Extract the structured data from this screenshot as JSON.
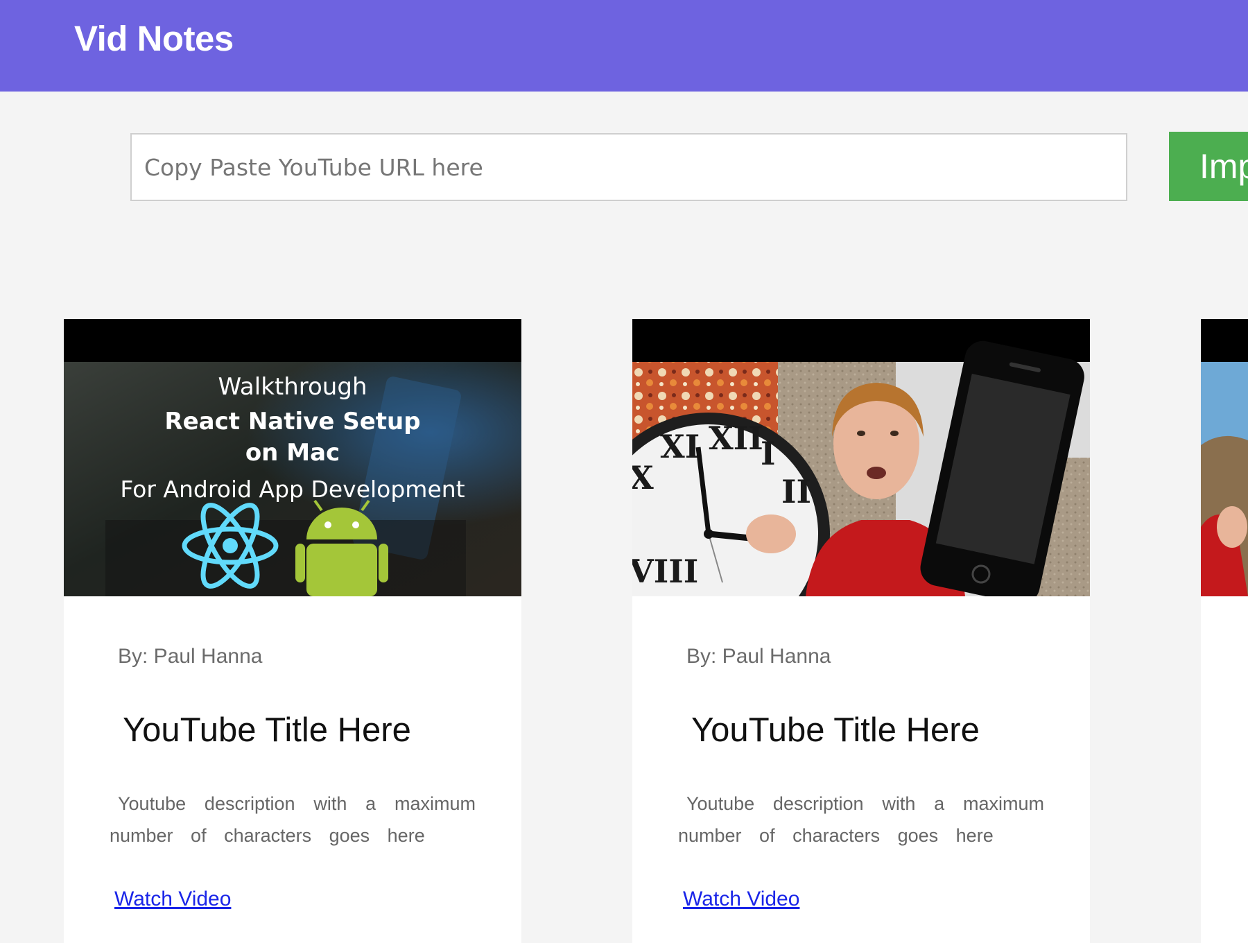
{
  "header": {
    "brand": "Vid Notes"
  },
  "search": {
    "placeholder": "Copy Paste YouTube URL here",
    "value": "",
    "button_label": "Imp"
  },
  "cards": [
    {
      "thumbnail": {
        "line1": "Walkthrough",
        "line2": "React Native Setup",
        "line3": "on Mac",
        "line4": "For Android App Development"
      },
      "author": "By: Paul Hanna",
      "title": "YouTube Title Here",
      "description": "Youtube description with a maximum number of characters goes here",
      "link": "Watch Video"
    },
    {
      "author": "By: Paul Hanna",
      "title": "YouTube Title Here",
      "description": "Youtube description with a maximum number of characters goes here",
      "link": "Watch Video"
    }
  ],
  "colors": {
    "header": "#6e63e0",
    "import_button": "#4cae50",
    "link": "#1a25e8",
    "page_background": "#f4f4f4"
  }
}
